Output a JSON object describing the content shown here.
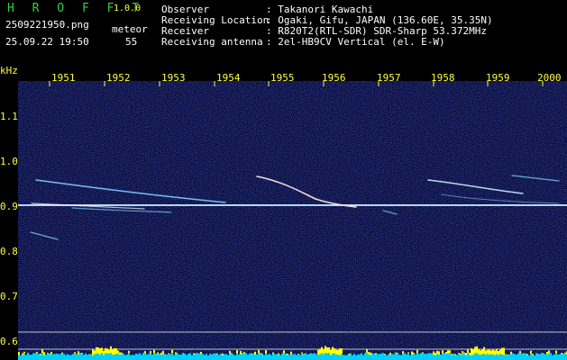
{
  "header": {
    "app_name": "H R O F F T",
    "version": "1.0.0",
    "filename": "2509221950.png",
    "datetime": "25.09.22 19:50",
    "meteor_label": "meteor",
    "meteor_count": "55",
    "info": [
      {
        "label": "Observer",
        "value": ": Takanori Kawachi"
      },
      {
        "label": "Receiving Location",
        "value": ": Ogaki, Gifu, JAPAN (136.60E, 35.35N)"
      },
      {
        "label": "Receiver",
        "value": ": R820T2(RTL-SDR) SDR-Sharp 53.372MHz"
      },
      {
        "label": "Receiving antenna",
        "value": ": 2el-HB9CV Vertical (el. E-W)"
      }
    ]
  },
  "axis": {
    "y_unit": "kHz",
    "y_ticks": [
      "1.1",
      "1.0",
      "0.9",
      "0.8",
      "0.7",
      "0.6"
    ],
    "x_ticks": [
      "1951",
      "1952",
      "1953",
      "1954",
      "1955",
      "1956",
      "1957",
      "1958",
      "1959",
      "2000"
    ]
  },
  "colors": {
    "background": "#000000",
    "plot_bg": "#0a0a3a",
    "label": "#ffff40",
    "title": "#2ad24a",
    "trace": "#ffffff",
    "bar_yellow": "#ffff00",
    "bar_cyan": "#00d0ff"
  }
}
